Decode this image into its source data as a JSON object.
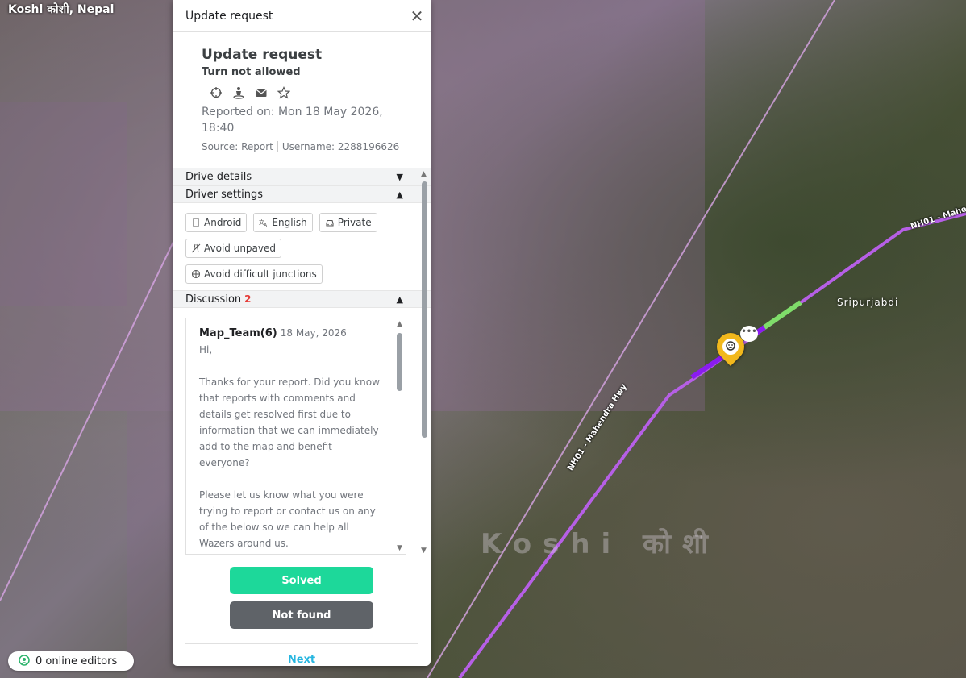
{
  "map": {
    "region_label": "Koshi कोशी, Nepal",
    "place_label": "Sripurjabdi",
    "watermark": "Koshi कोशी",
    "road_label_a": "NH01 - Mahe",
    "road_label_b": "NH01 - Mahendra Hwy",
    "bubble": "•••"
  },
  "editors": {
    "label": "0 online editors"
  },
  "panel": {
    "header_title": "Update request",
    "close": "✕",
    "title": "Update request",
    "subtitle": "Turn not allowed",
    "reported": "Reported on: Mon 18 May 2026, 18:40",
    "source": "Source: Report",
    "username": "Username: 2288196626",
    "sections": {
      "drive_details": "Drive details",
      "driver_settings": "Driver settings",
      "discussion": "Discussion",
      "discussion_count": "2"
    },
    "chips": [
      "Android",
      "English",
      "Private",
      "Avoid unpaved",
      "Avoid difficult junctions"
    ],
    "message": {
      "author": "Map_Team(6)",
      "date": "18 May, 2026",
      "line1": "Hi,",
      "para1": "Thanks for your report. Did you know that reports with comments and details get resolved first due to information that we can immediately add to the map and benefit everyone?",
      "para2": "Please let us know what you were trying to report or contact us on any of the below so we can help all Wazers around us."
    },
    "buttons": {
      "solved": "Solved",
      "not_found": "Not found",
      "next": "Next"
    }
  },
  "colors": {
    "accent_green": "#1dd89a",
    "next_blue": "#27b6e0",
    "road_purple": "#b65fe6",
    "segment_green": "#7fdd6a",
    "pin_yellow": "#f2b81c"
  }
}
